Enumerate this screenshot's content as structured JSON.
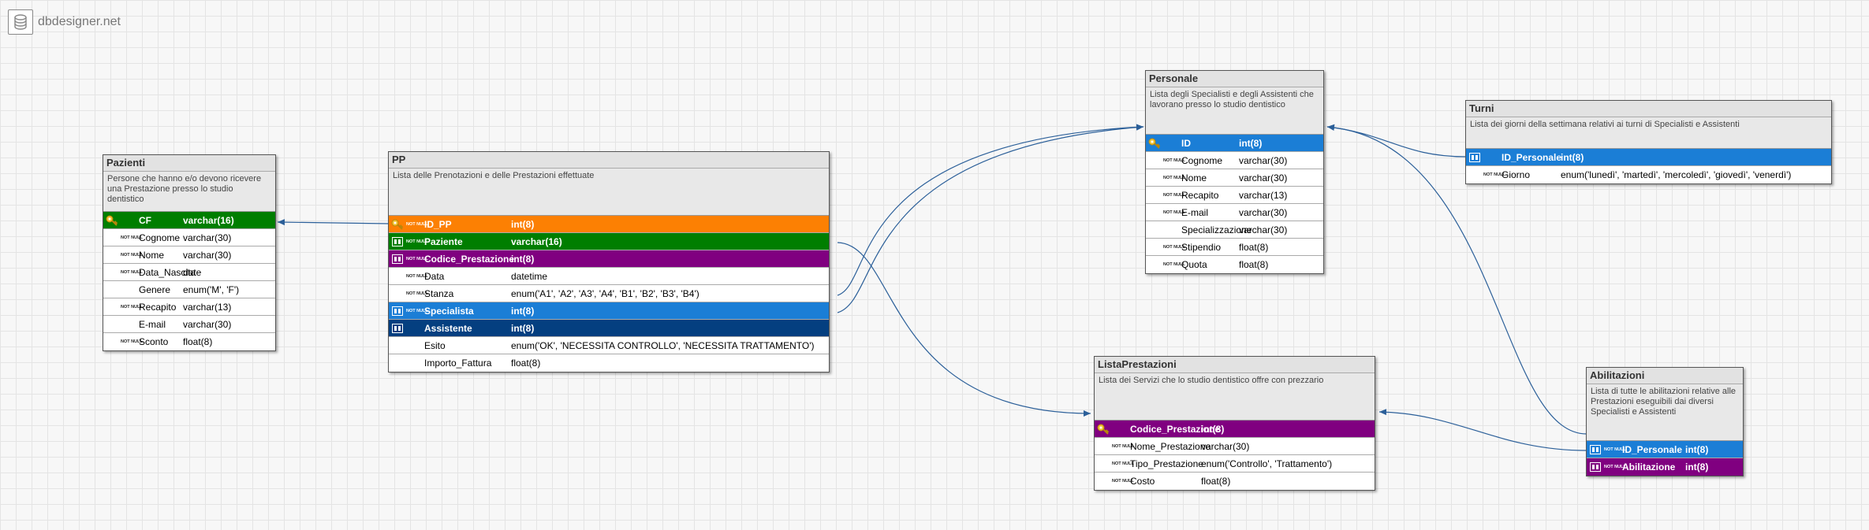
{
  "app": {
    "title": "dbdesigner.net",
    "logo": "database-icon"
  },
  "colors": {
    "pk": "#fc8003",
    "fk_green": "#007e00",
    "purple": "#800080",
    "blue_light": "#1b7ed6",
    "blue_dark": "#043f80",
    "link": "#2b5f99"
  },
  "tables": {
    "pazienti": {
      "name": "Pazienti",
      "desc": "Persone che hanno e/o devono ricevere una Prestazione presso lo studio dentistico",
      "rows": [
        {
          "name": "CF",
          "type": "varchar(16)",
          "notnull": "",
          "icon": "key-icon",
          "bg": "#007e00"
        },
        {
          "name": "Cognome",
          "type": "varchar(30)",
          "notnull": "NOT NULL",
          "icon": "",
          "bg": ""
        },
        {
          "name": "Nome",
          "type": "varchar(30)",
          "notnull": "NOT NULL",
          "icon": "",
          "bg": ""
        },
        {
          "name": "Data_Nascita",
          "type": "date",
          "notnull": "NOT NULL",
          "icon": "",
          "bg": ""
        },
        {
          "name": "Genere",
          "type": "enum('M', 'F')",
          "notnull": "",
          "icon": "",
          "bg": ""
        },
        {
          "name": "Recapito",
          "type": "varchar(13)",
          "notnull": "NOT NULL",
          "icon": "",
          "bg": ""
        },
        {
          "name": "E-mail",
          "type": "varchar(30)",
          "notnull": "",
          "icon": "",
          "bg": ""
        },
        {
          "name": "Sconto",
          "type": "float(8)",
          "notnull": "NOT NULL",
          "icon": "",
          "bg": ""
        }
      ]
    },
    "pp": {
      "name": "PP",
      "desc": "Lista delle Prenotazioni e delle Prestazioni effettuate",
      "rows": [
        {
          "name": "ID_PP",
          "type": "int(8)",
          "notnull": "NOT NULL",
          "icon": "key-icon",
          "bg": "#fc8003"
        },
        {
          "name": "Paziente",
          "type": "varchar(16)",
          "notnull": "NOT NULL",
          "icon": "foreign-key-icon",
          "bg": "#007e00"
        },
        {
          "name": "Codice_Prestazione",
          "type": "int(8)",
          "notnull": "NOT NULL",
          "icon": "foreign-key-icon",
          "bg": "#800080"
        },
        {
          "name": "Data",
          "type": "datetime",
          "notnull": "NOT NULL",
          "icon": "",
          "bg": ""
        },
        {
          "name": "Stanza",
          "type": "enum('A1', 'A2', 'A3', 'A4', 'B1', 'B2', 'B3', 'B4')",
          "notnull": "NOT NULL",
          "icon": "",
          "bg": ""
        },
        {
          "name": "Specialista",
          "type": "int(8)",
          "notnull": "NOT NULL",
          "icon": "foreign-key-icon",
          "bg": "#1b7ed6"
        },
        {
          "name": "Assistente",
          "type": "int(8)",
          "notnull": "",
          "icon": "foreign-key-icon",
          "bg": "#043f80"
        },
        {
          "name": "Esito",
          "type": "enum('OK', 'NECESSITA CONTROLLO', 'NECESSITA TRATTAMENTO')",
          "notnull": "",
          "icon": "",
          "bg": ""
        },
        {
          "name": "Importo_Fattura",
          "type": "float(8)",
          "notnull": "",
          "icon": "",
          "bg": ""
        }
      ]
    },
    "personale": {
      "name": "Personale",
      "desc": "Lista degli Specialisti e degli Assistenti che lavorano presso lo studio dentistico",
      "rows": [
        {
          "name": "ID",
          "type": "int(8)",
          "notnull": "",
          "icon": "key-icon",
          "bg": "#1b7ed6"
        },
        {
          "name": "Cognome",
          "type": "varchar(30)",
          "notnull": "NOT NULL",
          "icon": "",
          "bg": ""
        },
        {
          "name": "Nome",
          "type": "varchar(30)",
          "notnull": "NOT NULL",
          "icon": "",
          "bg": ""
        },
        {
          "name": "Recapito",
          "type": "varchar(13)",
          "notnull": "NOT NULL",
          "icon": "",
          "bg": ""
        },
        {
          "name": "E-mail",
          "type": "varchar(30)",
          "notnull": "NOT NULL",
          "icon": "",
          "bg": ""
        },
        {
          "name": "Specializzazione",
          "type": "varchar(30)",
          "notnull": "",
          "icon": "",
          "bg": ""
        },
        {
          "name": "Stipendio",
          "type": "float(8)",
          "notnull": "NOT NULL",
          "icon": "",
          "bg": ""
        },
        {
          "name": "Quota",
          "type": "float(8)",
          "notnull": "NOT NULL",
          "icon": "",
          "bg": ""
        }
      ]
    },
    "turni": {
      "name": "Turni",
      "desc": "Lista dei giorni della settimana relativi ai turni di Specialisti e Assistenti",
      "rows": [
        {
          "name": "ID_Personale",
          "type": "int(8)",
          "notnull": "",
          "icon": "foreign-key-icon",
          "bg": "#1b7ed6"
        },
        {
          "name": "Giorno",
          "type": "enum('lunedì', 'martedì', 'mercoledì', 'giovedì', 'venerdì')",
          "notnull": "NOT NULL",
          "icon": "",
          "bg": ""
        }
      ]
    },
    "lista_prestazioni": {
      "name": "ListaPrestazioni",
      "desc": "Lista dei Servizi che lo studio dentistico offre con prezzario",
      "rows": [
        {
          "name": "Codice_Prestazione",
          "type": "int(8)",
          "notnull": "",
          "icon": "key-icon",
          "bg": "#800080"
        },
        {
          "name": "Nome_Prestazione",
          "type": "varchar(30)",
          "notnull": "NOT NULL",
          "icon": "",
          "bg": ""
        },
        {
          "name": "Tipo_Prestazione",
          "type": "enum('Controllo', 'Trattamento')",
          "notnull": "NOT NULL",
          "icon": "",
          "bg": ""
        },
        {
          "name": "Costo",
          "type": "float(8)",
          "notnull": "NOT NULL",
          "icon": "",
          "bg": ""
        }
      ]
    },
    "abilitazioni": {
      "name": "Abilitazioni",
      "desc": "Lista di tutte le abilitazioni relative alle Prestazioni eseguibili dai diversi Specialisti e Assistenti",
      "rows": [
        {
          "name": "ID_Personale",
          "type": "int(8)",
          "notnull": "NOT NULL",
          "icon": "foreign-key-icon",
          "bg": "#1b7ed6"
        },
        {
          "name": "Abilitazione",
          "type": "int(8)",
          "notnull": "NOT NULL",
          "icon": "foreign-key-icon",
          "bg": "#800080"
        }
      ]
    }
  }
}
